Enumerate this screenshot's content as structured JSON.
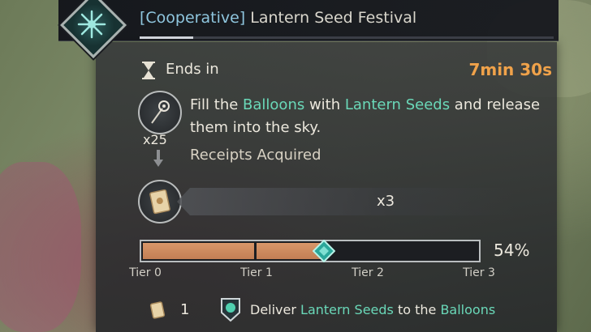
{
  "event": {
    "tag": "[Cooperative]",
    "name": "Lantern Seed Festival",
    "progress_fraction": 0.13
  },
  "timer": {
    "label": "Ends in",
    "value": "7min 30s"
  },
  "objective": {
    "seed_count": "x25",
    "desc_part1": "Fill the ",
    "desc_hl1": "Balloons",
    "desc_part2": " with ",
    "desc_hl2": "Lantern Seeds",
    "desc_part3": " and release them into the sky.",
    "receipts_label": "Receipts Acquired",
    "reward_qty": "x3"
  },
  "progress": {
    "percent_label": "54%",
    "fraction": 0.54,
    "tiers": [
      "Tier 0",
      "Tier 1",
      "Tier 2",
      "Tier 3"
    ]
  },
  "footer": {
    "receipt_count": "1",
    "deliver_part1": "Deliver ",
    "deliver_hl1": "Lantern Seeds",
    "deliver_part2": " to the ",
    "deliver_hl2": "Balloons"
  },
  "colors": {
    "highlight": "#6ad8b8",
    "timer": "#f0a24a",
    "bar_fill": "#c9865a",
    "tag": "#8fc6de"
  },
  "icons": [
    "hourglass-icon",
    "snowflake-emblem-icon",
    "lantern-seed-icon",
    "arrow-down-icon",
    "receipt-scroll-icon",
    "diamond-marker-icon",
    "map-pin-icon"
  ]
}
